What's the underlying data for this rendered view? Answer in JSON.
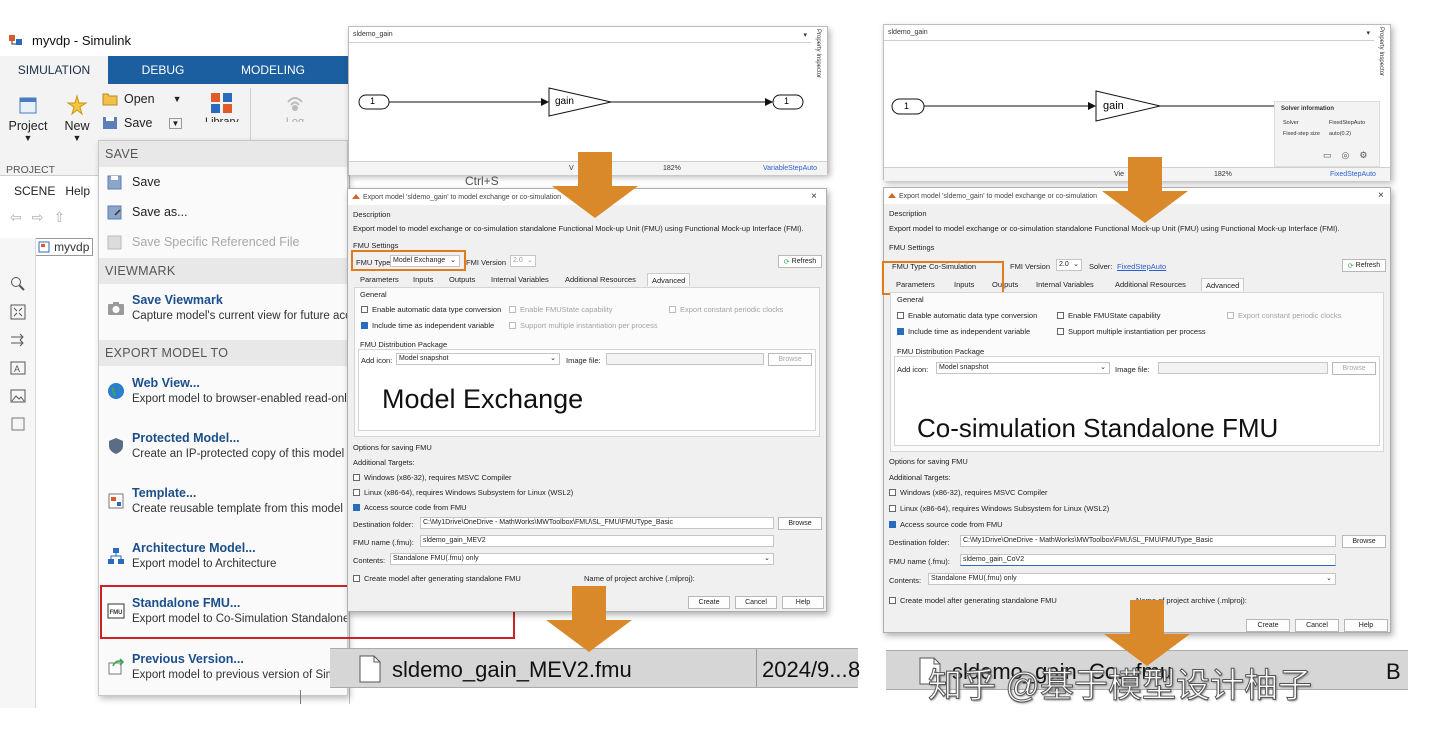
{
  "window": {
    "title": "myvdp - Simulink",
    "tabs": [
      "SIMULATION",
      "DEBUG",
      "MODELING"
    ],
    "ribbon": {
      "project": "Project",
      "new": "New",
      "open": "Open",
      "save": "Save",
      "library": "Library",
      "log": "Log",
      "project_group": "PROJECT"
    },
    "scene_tab": "SCENE",
    "help_tab": "Help",
    "model_breadcrumb": "myvdp",
    "shortcut": "Ctrl+S"
  },
  "menu": {
    "save_section": "SAVE",
    "save": "Save",
    "save_as": "Save as...",
    "save_specific": "Save Specific Referenced File",
    "viewmark_section": "VIEWMARK",
    "save_viewmark": {
      "title": "Save Viewmark",
      "desc": "Capture model's current view for future acc"
    },
    "export_section": "EXPORT MODEL TO",
    "items": [
      {
        "title": "Web View...",
        "desc": "Export model to browser-enabled read-only"
      },
      {
        "title": "Protected Model...",
        "desc": "Create an IP-protected copy of this model"
      },
      {
        "title": "Template...",
        "desc": "Create reusable template from this model"
      },
      {
        "title": "Architecture Model...",
        "desc": "Export model to Architecture"
      },
      {
        "title": "Standalone FMU...",
        "desc": "Export model to Co-Simulation Standalone Functional Mock-up Unit (FMU)"
      },
      {
        "title": "Previous Version...",
        "desc": "Export model to previous version of Sim"
      }
    ]
  },
  "diagram_left": {
    "name": "sldemo_gain",
    "in_port": "1",
    "gain": "gain",
    "out_port": "1",
    "zoom": "182%",
    "solver": "VariableStepAuto",
    "view_hint": "V",
    "inspector": "Property Inspector"
  },
  "diagram_right": {
    "name": "sldemo_gain",
    "in_port": "1",
    "gain": "gain",
    "zoom": "182%",
    "solver": "FixedStepAuto",
    "view_hint": "Vie",
    "inspector": "Property Inspector",
    "solver_info": {
      "title": "Solver information",
      "solver_label": "Solver",
      "solver_value": "FixedStepAuto",
      "step_label": "Fixed-step size",
      "step_value": "auto(0.2)"
    }
  },
  "dialog_left": {
    "title": "Export model 'sldemo_gain' to model exchange or co-simulation",
    "description_label": "Description",
    "description": "Export model to model exchange or co-simulation standalone Functional Mock-up Unit (FMU) using Functional Mock-up Interface (FMI).",
    "fmu_settings": "FMU Settings",
    "fmu_type_label": "FMU Type",
    "fmu_type_value": "Model Exchange",
    "fmi_version_label": "FMI Version",
    "fmi_version_value": "2.0",
    "refresh": "Refresh",
    "tabs": [
      "Parameters",
      "Inputs",
      "Outputs",
      "Internal Variables",
      "Additional Resources",
      "Advanced"
    ],
    "general": "General",
    "opt_auto_type": "Enable automatic data type conversion",
    "opt_fmustate": "Enable FMUState capability",
    "opt_periodic": "Export constant periodic clocks",
    "opt_time": "Include time as independent variable",
    "opt_multi": "Support multiple instantiation per process",
    "package": "FMU Distribution Package",
    "add_icon_label": "Add icon:",
    "add_icon_value": "Model snapshot",
    "image_file_label": "Image file:",
    "browse": "Browse",
    "big_label": "Model Exchange",
    "options_saving": "Options for saving FMU",
    "additional_targets": "Additional Targets:",
    "target_win": "Windows (x86-32), requires MSVC Compiler",
    "target_linux": "Linux (x86-64), requires Windows Subsystem for Linux (WSL2)",
    "access_source": "Access source code from FMU",
    "dest_label": "Destination folder:",
    "dest_value": "C:\\My1Drive\\OneDrive - MathWorks\\MWToolbox\\FMU\\SL_FMU\\FMUType_Basic",
    "browse2": "Browse",
    "name_label": "FMU name (.fmu):",
    "name_value": "sldemo_gain_MEV2",
    "contents_label": "Contents:",
    "contents_value": "Standalone FMU(.fmu) only",
    "create_model": "Create model after generating standalone FMU",
    "archive": "Name of project archive (.mlproj):",
    "create": "Create",
    "cancel": "Cancel",
    "help": "Help"
  },
  "dialog_right": {
    "title": "Export model 'sldemo_gain' to model exchange or co-simulation",
    "description_label": "Description",
    "description": "Export model to model exchange or co-simulation standalone Functional Mock-up Unit (FMU) using Functional Mock-up Interface (FMI).",
    "fmu_settings": "FMU Settings",
    "fmu_type_label": "FMU Type",
    "fmu_type_value": "Co-Simulation",
    "fmi_version_label": "FMI Version",
    "fmi_version_value": "2.0",
    "solver_label": "Solver:",
    "solver_value": "FixedStepAuto",
    "refresh": "Refresh",
    "tabs": [
      "Parameters",
      "Inputs",
      "Outputs",
      "Internal Variables",
      "Additional Resources",
      "Advanced"
    ],
    "general": "General",
    "opt_auto_type": "Enable automatic data type conversion",
    "opt_fmustate": "Enable FMUState capability",
    "opt_periodic": "Export constant periodic clocks",
    "opt_time": "Include time as independent variable",
    "opt_multi": "Support multiple instantiation per process",
    "package": "FMU Distribution Package",
    "add_icon_label": "Add icon:",
    "add_icon_value": "Model snapshot",
    "image_file_label": "Image file:",
    "browse": "Browse",
    "big_label": "Co-simulation Standalone FMU",
    "options_saving": "Options for saving FMU",
    "additional_targets": "Additional Targets:",
    "target_win": "Windows (x86-32), requires MSVC Compiler",
    "target_linux": "Linux (x86-64), requires Windows Subsystem for Linux (WSL2)",
    "access_source": "Access source code from FMU",
    "dest_label": "Destination folder:",
    "dest_value": "C:\\My1Drive\\OneDrive - MathWorks\\MWToolbox\\FMU\\SL_FMU\\FMUType_Basic",
    "browse2": "Browse",
    "name_label": "FMU name (.fmu):",
    "name_value": "sldemo_gain_CoV2",
    "contents_label": "Contents:",
    "contents_value": "Standalone FMU(.fmu) only",
    "create_model": "Create model after generating standalone FMU",
    "archive": "Name of project archive (.mlproj):",
    "create": "Create",
    "cancel": "Cancel",
    "help": "Help"
  },
  "file_left": {
    "name": "sldemo_gain_MEV2.fmu",
    "date": "2024/9...",
    "extra": "8"
  },
  "file_right": {
    "name": "sldemo_gain_Co...fmu",
    "date": "B"
  },
  "watermark": "知乎 @基于模型设计柚子",
  "colors": {
    "accent_blue": "#1b5fa0",
    "highlight_red": "#cc2222",
    "highlight_orange": "#e07c1c",
    "arrow": "#d9892a"
  }
}
